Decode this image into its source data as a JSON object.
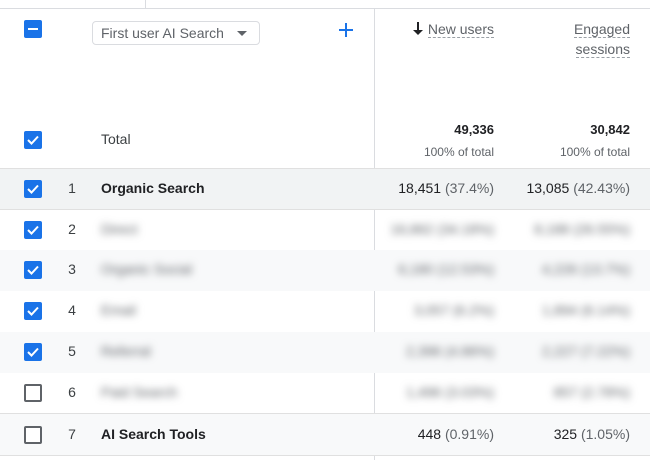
{
  "dimension_selector": {
    "value": "First user AI Search"
  },
  "columns": {
    "new_users": {
      "label": "New users",
      "sort": "descending"
    },
    "engaged_sessions": {
      "label_line1": "Engaged",
      "label_line2": "sessions"
    }
  },
  "total": {
    "label": "Total",
    "new_users": "49,336",
    "new_users_pct": "100% of total",
    "engaged_sessions": "30,842",
    "engaged_sessions_pct": "100% of total"
  },
  "rows": [
    {
      "num": "1",
      "name": "Organic Search",
      "new_users": "18,451",
      "new_users_pct": "(37.4%)",
      "engaged": "13,085",
      "engaged_pct": "(42.43%)",
      "checked": true
    },
    {
      "num": "2",
      "name": "Direct",
      "new_users": "16,862",
      "new_users_pct": "(34.18%)",
      "engaged": "8,188",
      "engaged_pct": "(26.55%)",
      "checked": true
    },
    {
      "num": "3",
      "name": "Organic Social",
      "new_users": "6,180",
      "new_users_pct": "(12.53%)",
      "engaged": "4,226",
      "engaged_pct": "(13.7%)",
      "checked": true
    },
    {
      "num": "4",
      "name": "Email",
      "new_users": "3,057",
      "new_users_pct": "(6.2%)",
      "engaged": "1,894",
      "engaged_pct": "(6.14%)",
      "checked": true
    },
    {
      "num": "5",
      "name": "Referral",
      "new_users": "2,396",
      "new_users_pct": "(4.86%)",
      "engaged": "2,227",
      "engaged_pct": "(7.22%)",
      "checked": true
    },
    {
      "num": "6",
      "name": "Paid Search",
      "new_users": "1,496",
      "new_users_pct": "(3.03%)",
      "engaged": "857",
      "engaged_pct": "(2.78%)",
      "checked": false
    },
    {
      "num": "7",
      "name": "AI Search Tools",
      "new_users": "448",
      "new_users_pct": "(0.91%)",
      "engaged": "325",
      "engaged_pct": "(1.05%)",
      "checked": false
    }
  ]
}
